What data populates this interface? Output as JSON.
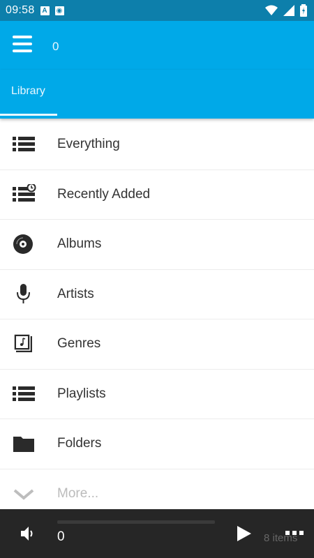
{
  "status_bar": {
    "time": "09:58"
  },
  "toolbar": {
    "title": "0",
    "menu_icon": "hamburger-icon"
  },
  "tabs": [
    {
      "label": "Library",
      "selected": true
    }
  ],
  "library": {
    "items": [
      {
        "label": "Everything",
        "icon": "list-icon"
      },
      {
        "label": "Recently Added",
        "icon": "recent-list-icon"
      },
      {
        "label": "Albums",
        "icon": "album-disc-icon"
      },
      {
        "label": "Artists",
        "icon": "microphone-icon"
      },
      {
        "label": "Genres",
        "icon": "music-note-box-icon"
      },
      {
        "label": "Playlists",
        "icon": "list-icon"
      },
      {
        "label": "Folders",
        "icon": "folder-icon"
      },
      {
        "label": "More...",
        "icon": "chevron-down-icon"
      }
    ]
  },
  "player": {
    "time": "0",
    "items_count": "8 items",
    "progress": 0
  },
  "colors": {
    "status_bar": "#0d7fab",
    "primary": "#00a9e8",
    "player_bg": "#262626"
  }
}
